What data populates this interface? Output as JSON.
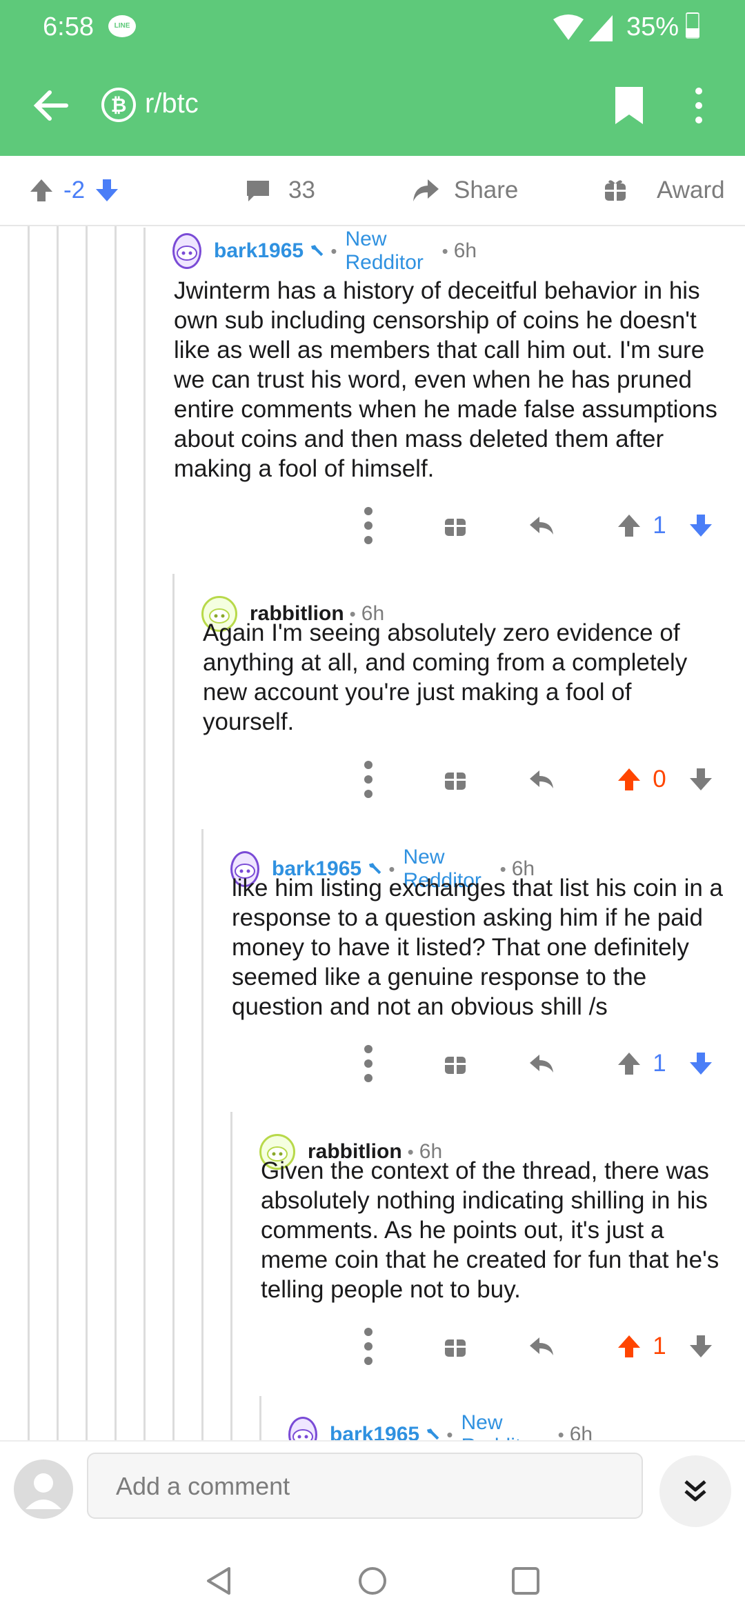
{
  "status_bar": {
    "time": "6:58",
    "notification_badge": "LINE",
    "battery": "35%"
  },
  "app_bar": {
    "subreddit": "r/btc",
    "subreddit_icon": "bitcoin-icon"
  },
  "action_bar": {
    "score": "-2",
    "comments": "33",
    "share_label": "Share",
    "award_label": "Award"
  },
  "comments": [
    {
      "author": "bark1965",
      "is_op": true,
      "flair": "New Redditor",
      "age": "6h",
      "body": "Jwinterm has a history of deceitful behavior in his own sub including censorship of coins he doesn't like as well as members that call him out. I'm sure we can trust his word, even when he has pruned entire comments when he made false assumptions about coins and then mass deleted them after making a fool of himself.",
      "score": "1",
      "vote_state": "down"
    },
    {
      "author": "rabbitlion",
      "is_op": false,
      "flair": "",
      "age": "6h",
      "body": "Again I'm seeing absolutely zero evidence of anything at all, and coming from a completely new account you're just making a fool of yourself.",
      "score": "0",
      "vote_state": "up"
    },
    {
      "author": "bark1965",
      "is_op": true,
      "flair": "New Redditor",
      "age": "6h",
      "body": "like him listing exchanges that list his coin in a response to a question asking him if he paid money to have it listed? That one definitely seemed like a genuine response to the question and not an obvious shill /s",
      "score": "1",
      "vote_state": "down"
    },
    {
      "author": "rabbitlion",
      "is_op": false,
      "flair": "",
      "age": "6h",
      "body": "Given the context of the thread, there was absolutely nothing indicating shilling in his comments. As he points out, it's just a meme coin that he created for fun that he's telling people not to buy.",
      "score": "1",
      "vote_state": "up"
    },
    {
      "author": "bark1965",
      "is_op": true,
      "flair": "New Redditor",
      "age": "6h",
      "body": "",
      "score": "",
      "vote_state": "none"
    }
  ],
  "composer": {
    "placeholder": "Add a comment"
  },
  "colors": {
    "header_green": "#5ec97a",
    "link_blue": "#2f91e0",
    "downvote_blue": "#4a7ef7",
    "upvote_orange": "#ff4500"
  }
}
